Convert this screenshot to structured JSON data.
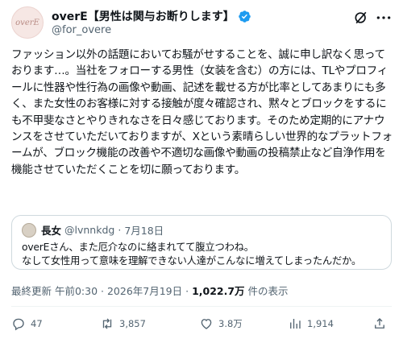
{
  "author": {
    "avatar_text": "overE",
    "display_name": "overE【男性は関与お断りします】",
    "handle": "@for_overe",
    "verified_icon": "verified-badge-icon",
    "accent_color": "#1d9bf0"
  },
  "tweet": {
    "text": "ファッション以外の話題においてお騒がせすることを、誠に申し訳なく思っております…。当社をフォローする男性（女装を含む）の方には、TLやプロフィールに性器や性行為の画像や動画、記述を載せる方が比率としてあまりにも多く、また女性のお客様に対する接触が度々確認され、黙々とブロックをするにも不甲斐なさとやりきれなさを日々感じております。そのため定期的にアナウンスをさせていただいておりますが、Xという素晴らしい世界的なプラットフォームが、ブロック機能の改善や不適切な画像や動画の投稿禁止など自浄作用を機能させていただくことを切に願っております。"
  },
  "quote": {
    "name": "長女",
    "handle": "@lvnnkdg",
    "date": "7月18日",
    "line1": "overEさん、また厄介なのに絡まれてて腹立つわね。",
    "line2": "なして女性用って意味を理解できない人達がこんなに増えてしまったんだか。"
  },
  "meta": {
    "updated": "最終更新 午前0:30 · 2026年7月19日 · ",
    "views": "1,022.7万",
    "views_suffix": " 件の表示"
  },
  "actions": {
    "replies": "47",
    "reposts": "3,857",
    "likes": "3.8万",
    "views": "1,914"
  }
}
